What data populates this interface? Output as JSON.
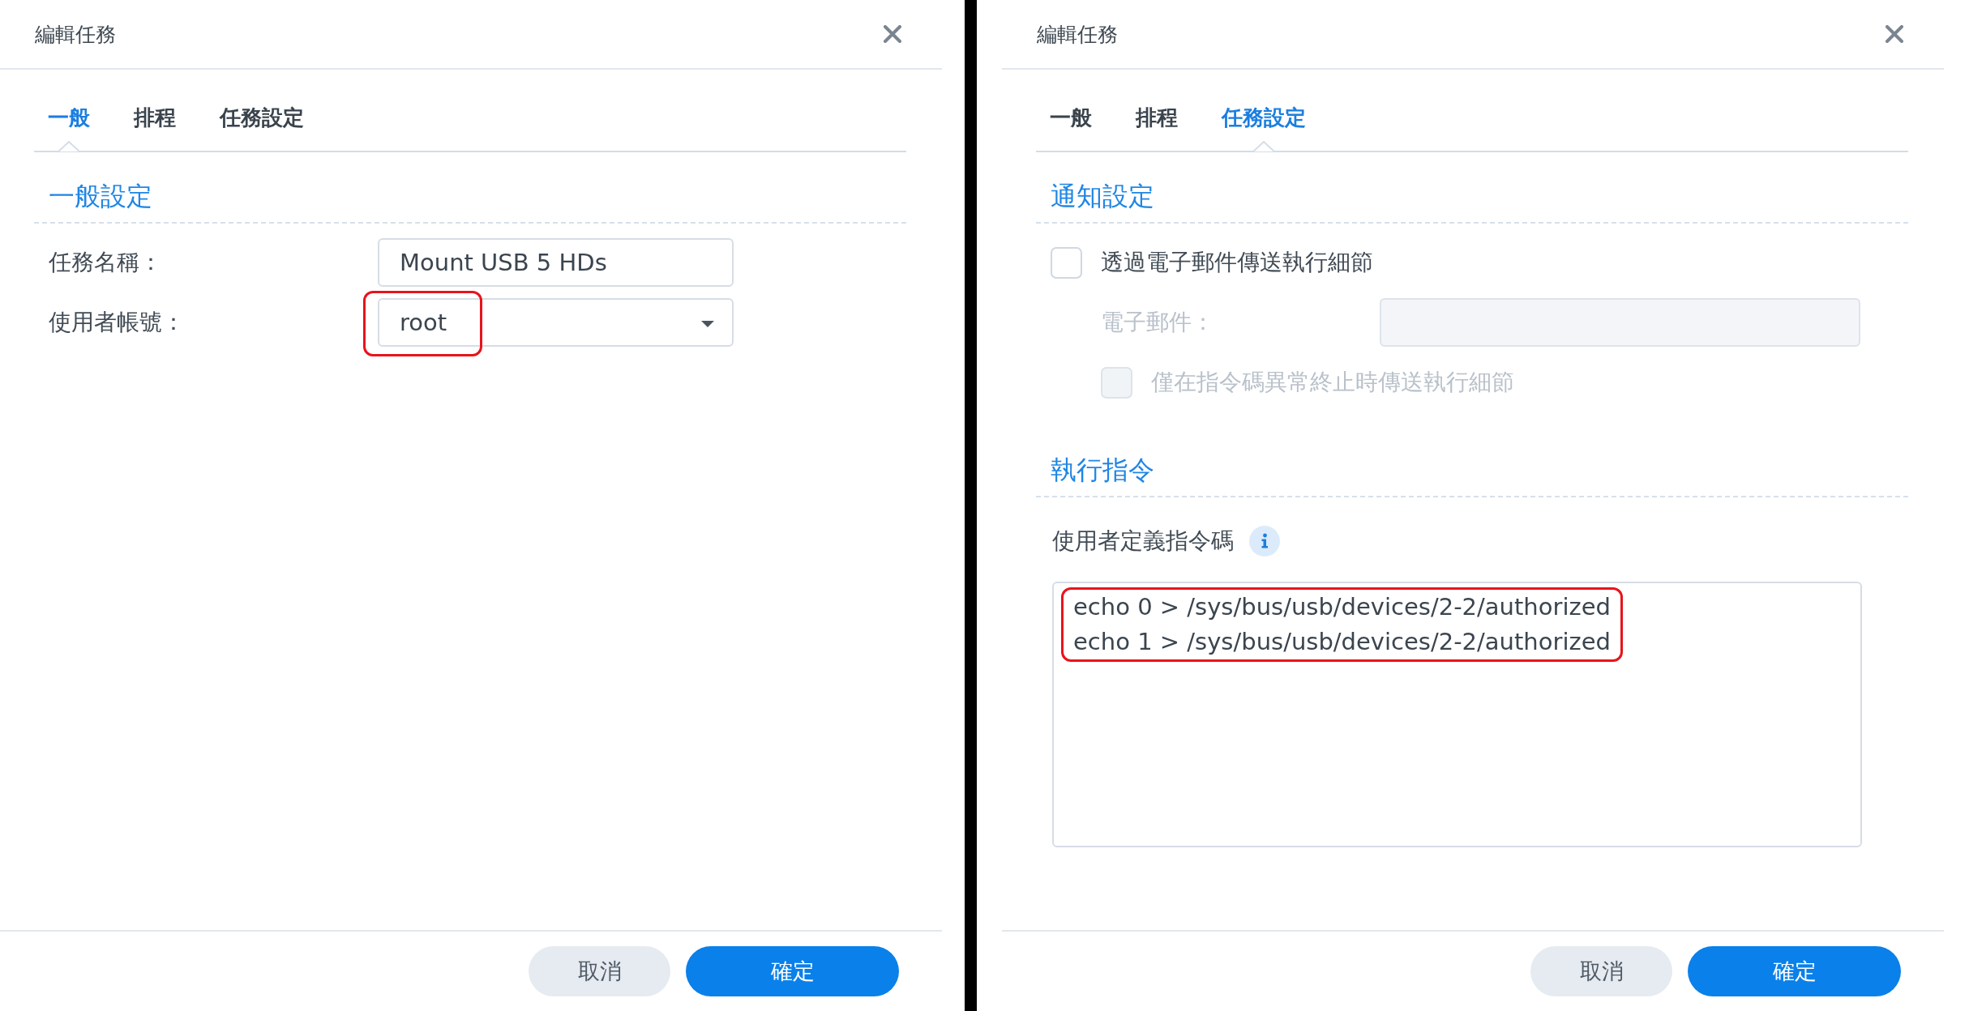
{
  "dialogs": [
    {
      "title": "編輯任務",
      "tabs": [
        {
          "label": "一般",
          "selected": true
        },
        {
          "label": "排程",
          "selected": false
        },
        {
          "label": "任務設定",
          "selected": false
        }
      ],
      "sections": [
        {
          "heading": "一般設定",
          "items": [
            {
              "kind": "text",
              "label": "任務名稱：",
              "value": "Mount USB 5 HDs",
              "disabled": false
            },
            {
              "kind": "select",
              "label": "使用者帳號：",
              "value": "root",
              "disabled": false,
              "highlighted": true
            }
          ]
        }
      ],
      "buttons": [
        {
          "kind": "secondary",
          "label": "取消"
        },
        {
          "kind": "primary",
          "label": "確定"
        }
      ]
    },
    {
      "title": "編輯任務",
      "tabs": [
        {
          "label": "一般",
          "selected": false
        },
        {
          "label": "排程",
          "selected": false
        },
        {
          "label": "任務設定",
          "selected": true
        }
      ],
      "sections": [
        {
          "heading": "通知設定",
          "items": [
            {
              "kind": "checkbox",
              "label": "透過電子郵件傳送執行細節",
              "checked": false,
              "disabled": false,
              "children": [
                {
                  "kind": "text",
                  "label": "電子郵件：",
                  "disabled": true
                },
                {
                  "kind": "checkbox",
                  "label": "僅在指令碼異常終止時傳送執行細節",
                  "checked": false,
                  "disabled": true
                }
              ]
            }
          ]
        },
        {
          "heading": "執行指令",
          "items": [
            {
              "kind": "script",
              "label": "使用者定義指令碼",
              "info": true,
              "highlighted": true,
              "lines": [
                "echo 0 > /sys/bus/usb/devices/2-2/authorized",
                "echo 1 > /sys/bus/usb/devices/2-2/authorized"
              ]
            }
          ]
        }
      ],
      "buttons": [
        {
          "kind": "secondary",
          "label": "取消"
        },
        {
          "kind": "primary",
          "label": "確定"
        }
      ]
    }
  ]
}
